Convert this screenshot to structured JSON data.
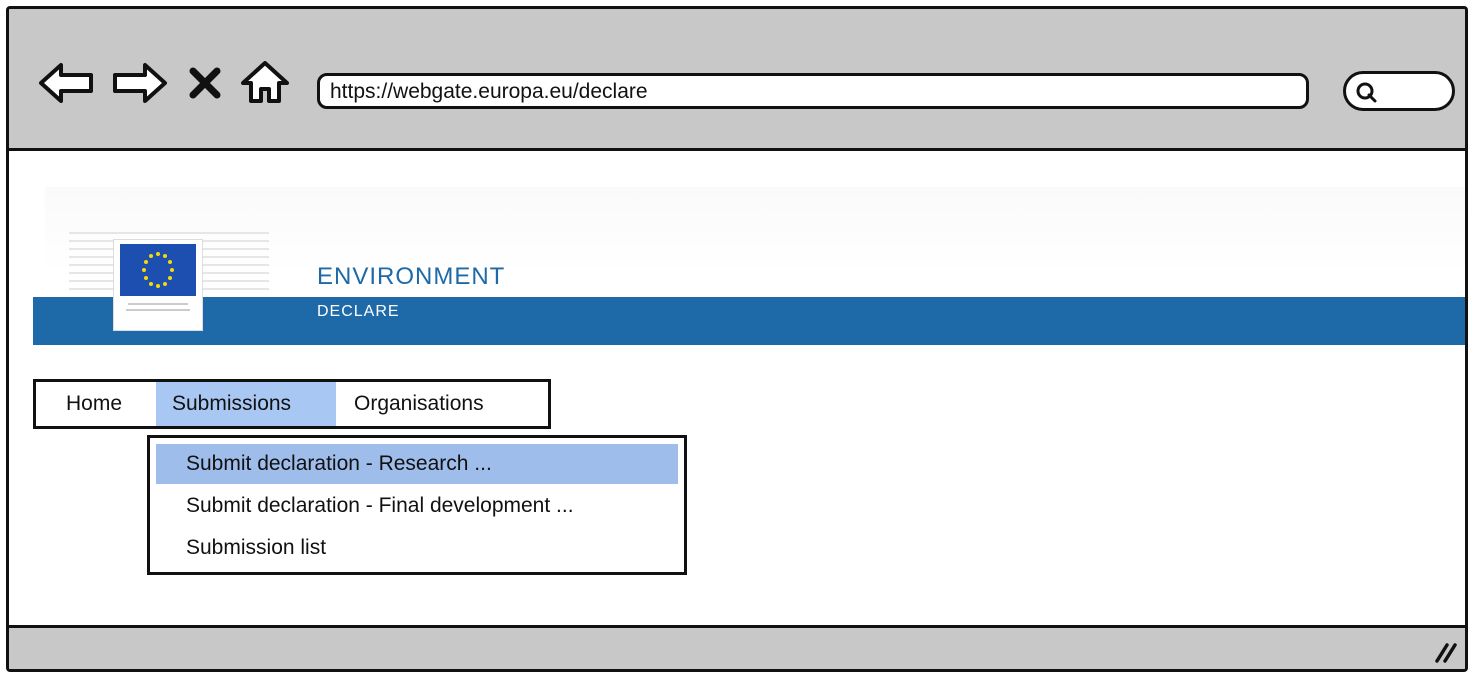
{
  "browser": {
    "icons": {
      "back": "arrow-left-icon",
      "forward": "arrow-right-icon",
      "stop": "close-icon",
      "home": "home-icon",
      "search": "search-icon",
      "resize": "resize-grip-icon"
    },
    "url": "https://webgate.europa.eu/declare"
  },
  "header": {
    "title": "ENVIRONMENT",
    "subtitle": "DECLARE",
    "logo_caption": "European Commission",
    "accent_color": "#1e6aa8"
  },
  "menu": {
    "items": [
      {
        "label": "Home"
      },
      {
        "label": "Submissions",
        "selected": true
      },
      {
        "label": "Organisations"
      }
    ]
  },
  "dropdown": {
    "items": [
      {
        "label": "Submit declaration - Research ...",
        "selected": true
      },
      {
        "label": "Submit declaration - Final development ..."
      },
      {
        "label": "Submission list"
      }
    ]
  }
}
